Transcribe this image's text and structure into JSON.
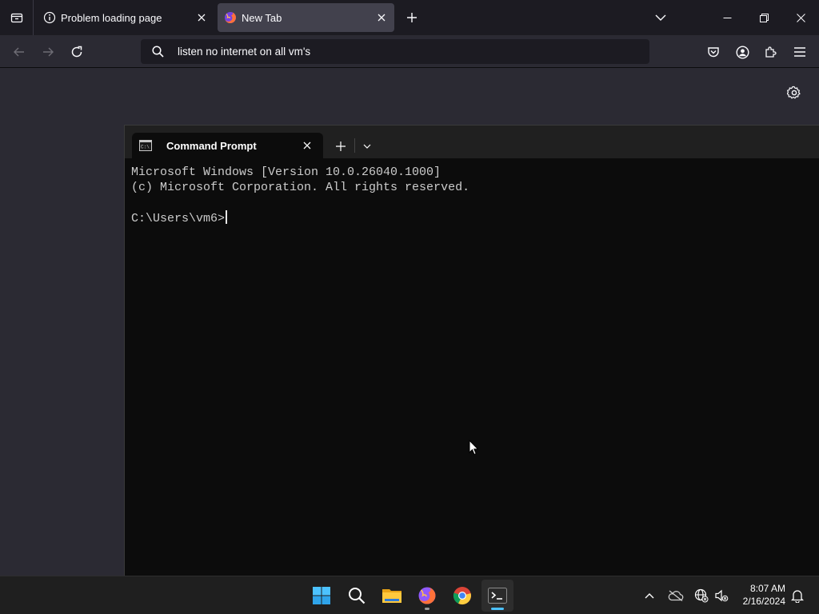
{
  "browser": {
    "tabs": [
      {
        "title": "Problem loading page",
        "icon": "info-icon",
        "active": false
      },
      {
        "title": "New Tab",
        "icon": "firefox-icon",
        "active": true
      }
    ],
    "url_text": "listen no internet on all vm's"
  },
  "terminal": {
    "tab_title": "Command Prompt",
    "lines": [
      "Microsoft Windows [Version 10.0.26040.1000]",
      "(c) Microsoft Corporation. All rights reserved.",
      "",
      "C:\\Users\\vm6>"
    ]
  },
  "taskbar": {
    "apps": [
      "windows-start-icon",
      "search-icon",
      "file-explorer-icon",
      "firefox-icon",
      "chrome-icon",
      "terminal-icon"
    ],
    "clock_time": "8:07 AM",
    "clock_date": "2/16/2024"
  },
  "colors": {
    "browser_bg": "#1c1b22",
    "toolbar_bg": "#2b2a33",
    "terminal_bg": "#0c0c0c",
    "taskbar_bg": "#1f1f1f",
    "accent": "#4cc2ff"
  }
}
